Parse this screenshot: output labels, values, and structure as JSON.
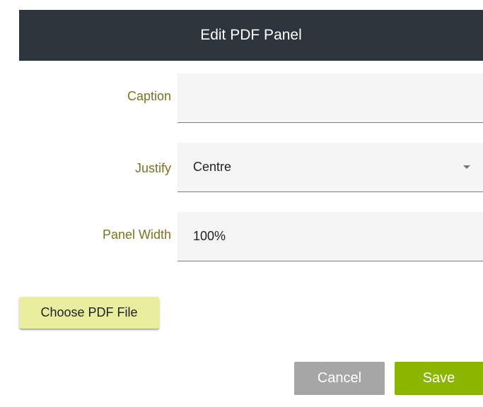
{
  "dialog": {
    "title": "Edit PDF Panel"
  },
  "form": {
    "caption": {
      "label": "Caption",
      "value": ""
    },
    "justify": {
      "label": "Justify",
      "selected": "Centre"
    },
    "panel_width": {
      "label": "Panel Width",
      "value": "100%"
    }
  },
  "actions": {
    "choose_file_label": "Choose PDF File",
    "cancel_label": "Cancel",
    "save_label": "Save"
  },
  "colors": {
    "header_bg": "#2b353b",
    "label_text": "#7a7320",
    "choose_button_bg": "#e8ee9d",
    "cancel_button_bg": "#a6a6a6",
    "save_button_bg": "#8cb500"
  },
  "icons": {
    "justify_dropdown": "chevron-down-icon"
  }
}
